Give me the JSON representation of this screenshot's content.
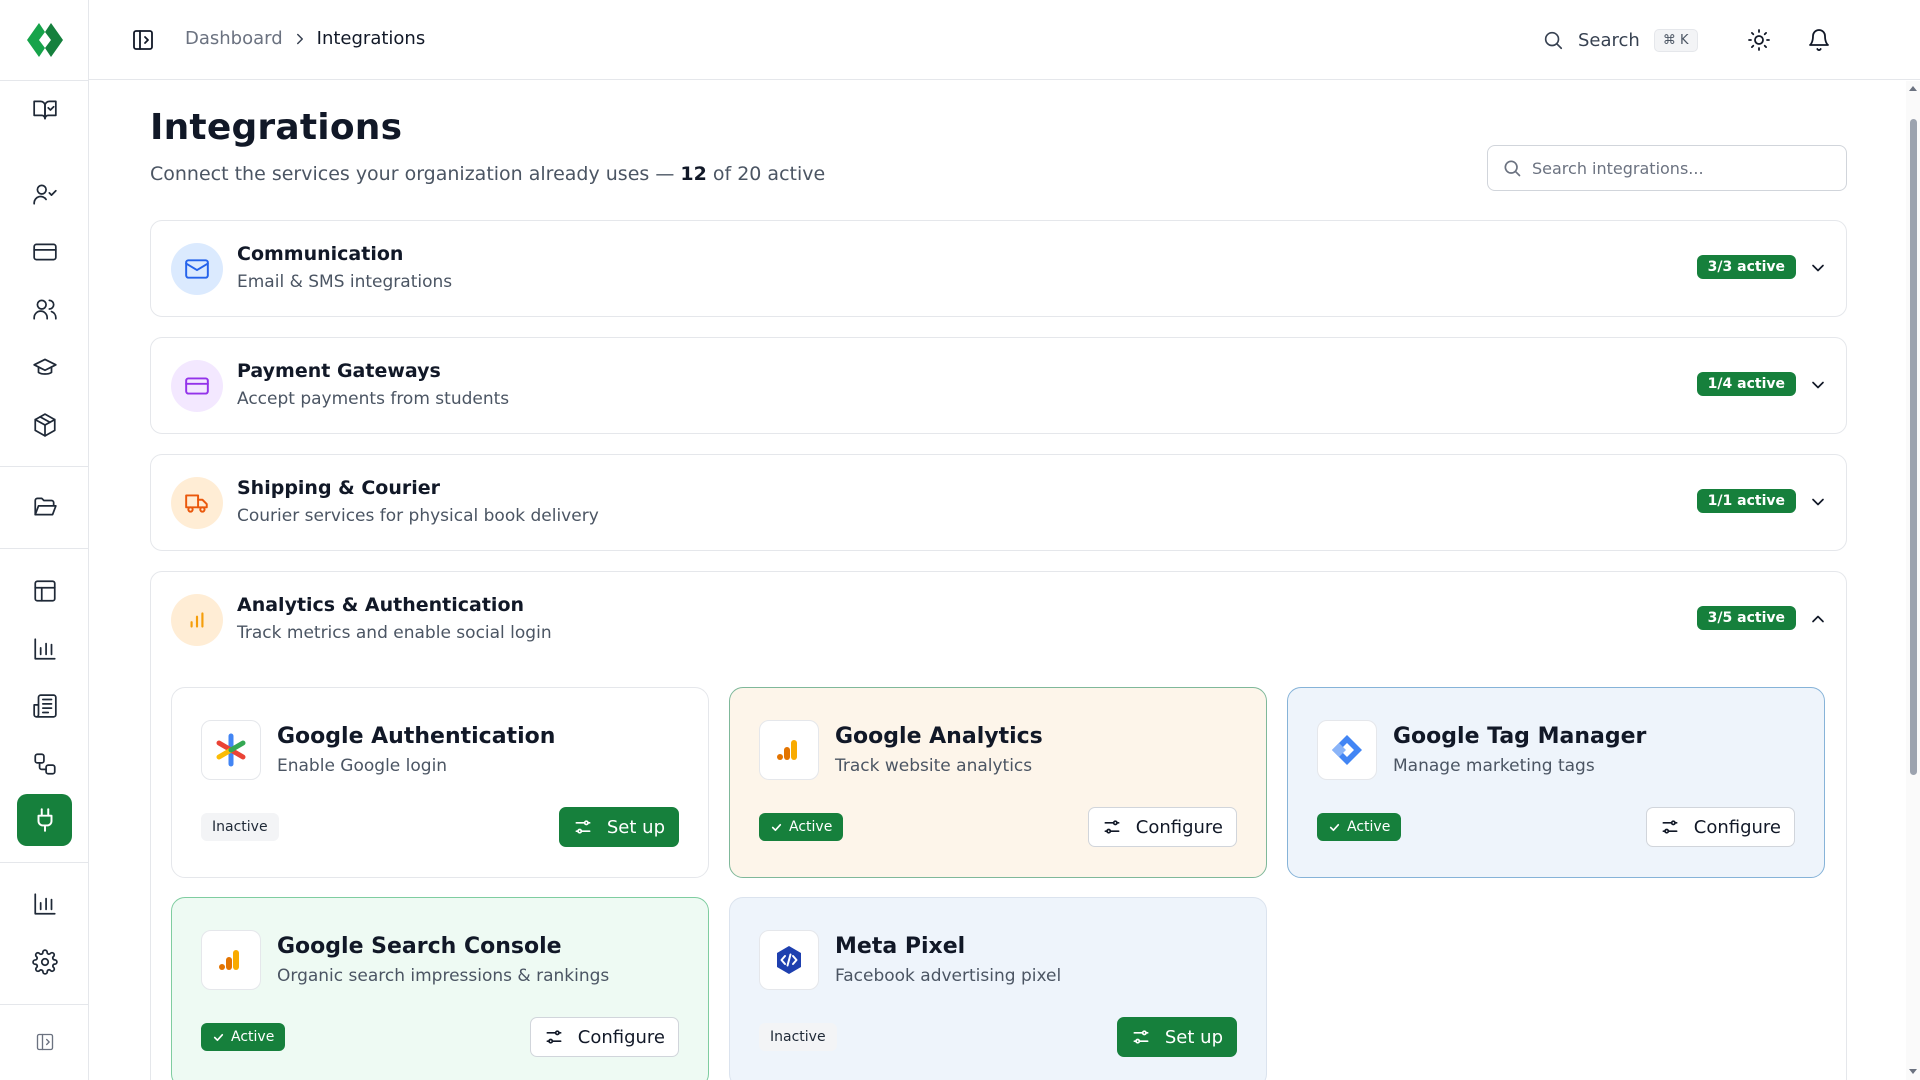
{
  "app": {
    "logo_color": "#16a34a",
    "accent": "#16803c"
  },
  "sidebar": {
    "items": [
      {
        "name": "library",
        "icon": "book-open-check-icon"
      },
      {
        "name": "users",
        "icon": "user-check-icon"
      },
      {
        "name": "billing",
        "icon": "credit-card-icon"
      },
      {
        "name": "people",
        "icon": "users-icon"
      },
      {
        "name": "courses",
        "icon": "graduation-cap-icon"
      },
      {
        "name": "packages",
        "icon": "package-icon"
      },
      {
        "name": "files",
        "icon": "folder-open-icon"
      },
      {
        "name": "layout",
        "icon": "layout-icon"
      },
      {
        "name": "reports",
        "icon": "bar-chart-icon"
      },
      {
        "name": "documents",
        "icon": "newspaper-icon"
      },
      {
        "name": "workflow",
        "icon": "workflow-icon"
      },
      {
        "name": "integrations",
        "icon": "plug-icon",
        "active": true
      },
      {
        "name": "analytics",
        "icon": "bar-chart-icon"
      },
      {
        "name": "settings",
        "icon": "gear-icon"
      }
    ]
  },
  "topbar": {
    "breadcrumb": {
      "parent": "Dashboard",
      "current": "Integrations"
    },
    "search_label": "Search",
    "search_shortcut": "⌘ K"
  },
  "page": {
    "title": "Integrations",
    "subtitle_prefix": "Connect the services your organization already uses — ",
    "active_count": "12",
    "subtitle_suffix": " of 20 active",
    "search_placeholder": "Search integrations..."
  },
  "categories": [
    {
      "title": "Communication",
      "subtitle": "Email & SMS integrations",
      "badge": "3/3 active",
      "expanded": false,
      "icon": "mail-icon"
    },
    {
      "title": "Payment Gateways",
      "subtitle": "Accept payments from students",
      "badge": "1/4 active",
      "expanded": false,
      "icon": "credit-card-icon"
    },
    {
      "title": "Shipping & Courier",
      "subtitle": "Courier services for physical book delivery",
      "badge": "1/1 active",
      "expanded": false,
      "icon": "truck-icon"
    },
    {
      "title": "Analytics & Authentication",
      "subtitle": "Track metrics and enable social login",
      "badge": "3/5 active",
      "expanded": true,
      "icon": "bar-chart-icon"
    }
  ],
  "integrations": [
    {
      "title": "Google Authentication",
      "description": "Enable Google login",
      "status": "Inactive",
      "action": "Set up",
      "icon": "google-auth-icon"
    },
    {
      "title": "Google Analytics",
      "description": "Track website analytics",
      "status": "Active",
      "action": "Configure",
      "icon": "google-analytics-icon"
    },
    {
      "title": "Google Tag Manager",
      "description": "Manage marketing tags",
      "status": "Active",
      "action": "Configure",
      "icon": "google-tag-manager-icon"
    },
    {
      "title": "Google Search Console",
      "description": "Organic search impressions & rankings",
      "status": "Active",
      "action": "Configure",
      "icon": "google-search-console-icon"
    },
    {
      "title": "Meta Pixel",
      "description": "Facebook advertising pixel",
      "status": "Inactive",
      "action": "Set up",
      "icon": "meta-pixel-icon"
    }
  ]
}
